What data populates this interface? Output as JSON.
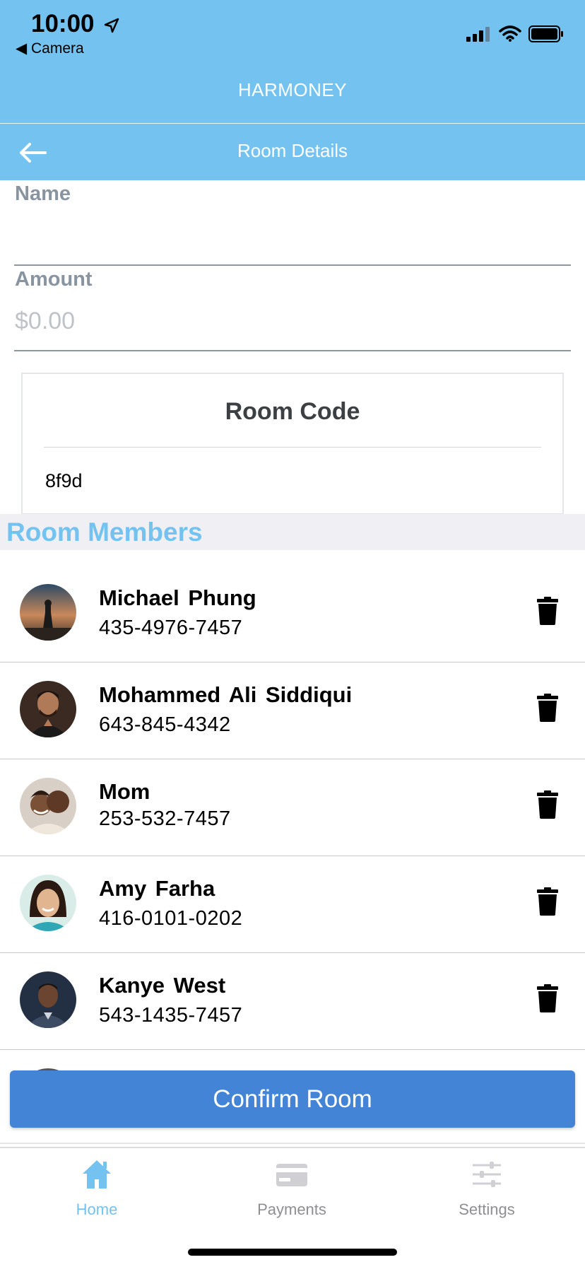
{
  "status_bar": {
    "time": "10:00",
    "back_app": "Camera"
  },
  "app": {
    "title": "HARMONEY"
  },
  "nav": {
    "title": "Room Details"
  },
  "form": {
    "name_label": "Name",
    "name_value": "",
    "amount_label": "Amount",
    "amount_placeholder": "$0.00"
  },
  "room_code": {
    "title": "Room Code",
    "value": "8f9d"
  },
  "members": {
    "title": "Room Members",
    "items": [
      {
        "name": "Michael Phung",
        "phone": "435-4976-7457"
      },
      {
        "name": "Mohammed Ali Siddiqui",
        "phone": "643-845-4342"
      },
      {
        "name": "Mom",
        "phone": "253-532-7457"
      },
      {
        "name": "Amy Farha",
        "phone": "416-0101-0202"
      },
      {
        "name": "Kanye West",
        "phone": "543-1435-7457"
      }
    ]
  },
  "confirm_button": {
    "label": "Confirm Room"
  },
  "tabs": [
    {
      "label": "Home",
      "icon": "home-icon",
      "active": true
    },
    {
      "label": "Payments",
      "icon": "credit-card-icon",
      "active": false
    },
    {
      "label": "Settings",
      "icon": "sliders-icon",
      "active": false
    }
  ],
  "colors": {
    "header": "#74c2ef",
    "accent": "#74c2ef",
    "button": "#4384d6",
    "label": "#8994a1"
  }
}
